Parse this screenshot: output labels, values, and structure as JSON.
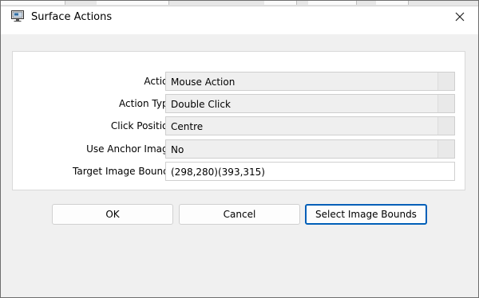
{
  "window": {
    "title": "Surface Actions",
    "icon": "surface-app-icon",
    "close_icon": "close-icon"
  },
  "fields": [
    {
      "label": "Action",
      "value": "Mouse Action",
      "kind": "dropdown"
    },
    {
      "label": "Action Type",
      "value": "Double Click",
      "kind": "dropdown"
    },
    {
      "label": "Click Position",
      "value": "Centre",
      "kind": "dropdown"
    },
    {
      "label": "Use Anchor Image",
      "value": "No",
      "kind": "dropdown"
    },
    {
      "label": "Target Image Bounds",
      "value": "(298,280)(393,315)",
      "kind": "text"
    }
  ],
  "buttons": {
    "ok": "OK",
    "cancel": "Cancel",
    "select_bounds": "Select Image Bounds"
  },
  "colors": {
    "accent": "#005fb8",
    "dialog_background": "#f0f0f0",
    "readonly_field": "#efefef"
  }
}
